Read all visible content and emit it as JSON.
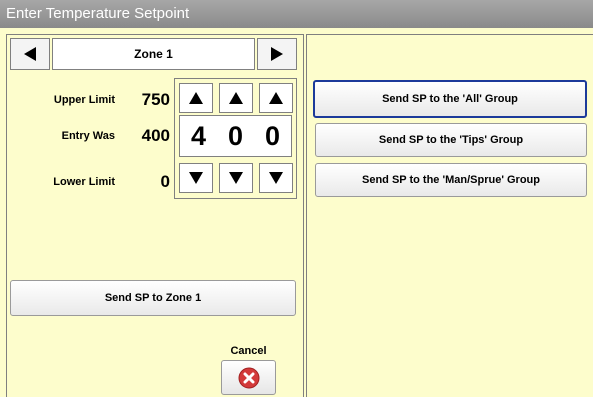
{
  "window": {
    "title": "Enter Temperature Setpoint"
  },
  "zone": {
    "label": "Zone 1"
  },
  "limits": {
    "upper_label": "Upper Limit",
    "upper_value": "750",
    "entry_label": "Entry Was",
    "entry_value": "400",
    "lower_label": "Lower Limit",
    "lower_value": "0"
  },
  "digits": [
    "4",
    "0",
    "0"
  ],
  "buttons": {
    "send_zone": "Send SP to Zone 1",
    "send_all": "Send SP to the 'All' Group",
    "send_tips": "Send SP to the 'Tips' Group",
    "send_man_sprue": "Send SP to the 'Man/Sprue' Group",
    "cancel_label": "Cancel"
  },
  "colors": {
    "panel_bg": "#fdfdcc",
    "title_bg": "#9a9a9a",
    "focus": "#1c3a9a",
    "cancel_icon": "#d33a3a"
  },
  "icons": [
    "left-arrow-icon",
    "right-arrow-icon",
    "up-arrow-icon",
    "down-arrow-icon",
    "cancel-x-icon"
  ]
}
